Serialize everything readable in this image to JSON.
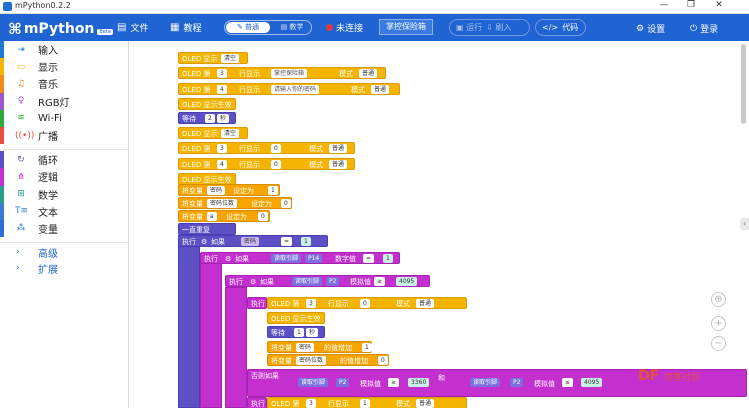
{
  "window": {
    "title": "mPython0.2.2",
    "minimize": "—",
    "restore": "❐",
    "close": "✕"
  },
  "header": {
    "logo_mark": "⌘",
    "logo_text": "mPython",
    "logo_badge": "Beta",
    "file_icon": "▤",
    "file": "文件",
    "tutorial_icon": "▦",
    "tutorial": "教程",
    "mode_normal": "普通",
    "mode_teach": "教学",
    "mode_normal_icon": "✎",
    "mode_teach_icon": "▤",
    "status": "未连接",
    "project": "掌控保险箱",
    "run_icon": "▣",
    "run": "运行",
    "flash_icon": "⇩",
    "flash": "刷入",
    "code_icon": "</>",
    "code": "代码",
    "settings_icon": "⚙",
    "settings": "设置",
    "login_icon": "⏻",
    "login": "登录"
  },
  "sidebar": {
    "items": [
      {
        "label": "输入",
        "icon": "⇥",
        "color": "#1f78d1"
      },
      {
        "label": "显示",
        "icon": "▭",
        "color": "#f4b400"
      },
      {
        "label": "音乐",
        "icon": "♫",
        "color": "#f28a1d"
      },
      {
        "label": "RGB灯",
        "icon": "♀",
        "color": "#9b59d0"
      },
      {
        "label": "Wi-Fi",
        "icon": "≋",
        "color": "#2daa3a"
      },
      {
        "label": "广播",
        "icon": "((•))",
        "color": "#e74c3c"
      }
    ],
    "items2": [
      {
        "label": "循环",
        "icon": "↻",
        "color": "#5c50c4"
      },
      {
        "label": "逻辑",
        "icon": "⋔",
        "color": "#c330cf"
      },
      {
        "label": "数学",
        "icon": "⊞",
        "color": "#2b9b8a"
      },
      {
        "label": "文本",
        "icon": "T≡",
        "color": "#3a7bd5"
      },
      {
        "label": "变量",
        "icon": "⁂",
        "color": "#2b6fd8"
      }
    ],
    "advanced": "高级",
    "extend": "扩展",
    "chev": "›"
  },
  "blocks": {
    "oled_display": "OLED 显示",
    "clear": "清空",
    "oled_row": "OLED 第",
    "row_show": "行显示",
    "mode": "模式",
    "normal": "普通",
    "title_str": "掌控保险箱",
    "prompt_str": "请输入你的密码",
    "q": "❝",
    "q2": "❞",
    "n3": "3",
    "n4": "4",
    "zero": "0",
    "one": "1",
    "oled_effect": "OLED 显示生效",
    "wait": "等待",
    "sec": "秒",
    "n2": "2",
    "set_var": "将变量",
    "set_to": "设定为",
    "v_pwd": "密码",
    "v_count": "密码位数",
    "v_a": "a",
    "forever": "一直重复",
    "exec": "执行",
    "if": "如果",
    "eq": "=",
    "read_pin": "读取引脚",
    "digital": "数字值",
    "analog": "模拟值",
    "p14": "P14",
    "p2": "P2",
    "v4095": "4095",
    "v3360": "3360",
    "v4095b": "4095",
    "gte": "≥",
    "lte": "≤",
    "and": "和",
    "add_val": "的值增加",
    "else_if": "否则如果"
  },
  "canvas": {
    "recenter_icon": "⊕",
    "zoom_in": "+",
    "zoom_out": "−",
    "collapse": "‹"
  },
  "watermark": {
    "text": "DF",
    "sub": "创客社区"
  }
}
